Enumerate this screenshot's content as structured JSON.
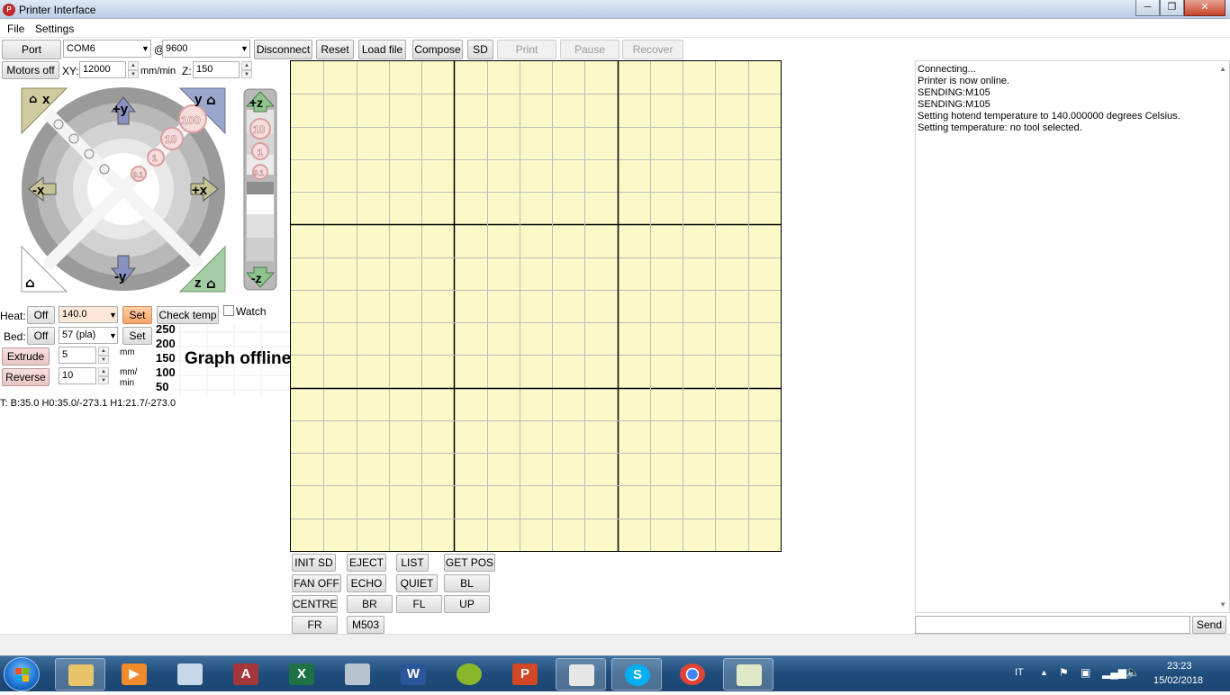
{
  "window": {
    "title": "Printer Interface",
    "icon_text": "P",
    "minimize": "─",
    "maximize": "❐",
    "close": "✕"
  },
  "menu": {
    "file": "File",
    "settings": "Settings"
  },
  "toolbar": {
    "port_label": "Port",
    "port_value": "COM6",
    "at": "@",
    "baud_value": "9600",
    "disconnect": "Disconnect",
    "reset": "Reset",
    "load_file": "Load file",
    "compose": "Compose",
    "sd": "SD",
    "print": "Print",
    "pause": "Pause",
    "recover": "Recover"
  },
  "motion": {
    "motors_off": "Motors off",
    "xy_label": "XY:",
    "xy_value": "12000",
    "xy_unit": "mm/min",
    "z_label": "Z:",
    "z_value": "150"
  },
  "jog": {
    "home_x": "x",
    "home_y": "y",
    "home_z": "z",
    "plus_y": "+y",
    "minus_y": "-y",
    "plus_x": "+x",
    "minus_x": "-x",
    "plus_z": "+z",
    "minus_z": "-z",
    "step_100": "100",
    "step_10": "10",
    "step_1": "1",
    "step_01": "0.1"
  },
  "heat": {
    "label": "Heat:",
    "off": "Off",
    "value": "140.0",
    "set": "Set",
    "check_temp": "Check temp",
    "watch": "Watch"
  },
  "bed": {
    "label": "Bed:",
    "off": "Off",
    "value": "57 (pla)",
    "set": "Set"
  },
  "extrude": {
    "extrude": "Extrude",
    "length": "5",
    "length_unit": "mm",
    "reverse": "Reverse",
    "speed": "10",
    "speed_unit_1": "mm/",
    "speed_unit_2": "min"
  },
  "graph": {
    "ticks": [
      "250",
      "200",
      "150",
      "100",
      "50"
    ],
    "offline": "Graph offline"
  },
  "temps": "T: B:35.0 H0:35.0/-273.1 H1:21.7/-273.0",
  "macros": {
    "init_sd": "INIT SD",
    "eject": "EJECT",
    "list": "LIST",
    "get_pos": "GET POS",
    "fan_off": "FAN OFF",
    "echo": "ECHO",
    "quiet": "QUIET",
    "bl": "BL",
    "centre": "CENTRE",
    "br": "BR",
    "fl": "FL",
    "up": "UP",
    "fr": "FR",
    "m503": "M503"
  },
  "log": {
    "lines": [
      "Connecting...",
      "Printer is now online.",
      "SENDING:M105",
      "SENDING:M105",
      "Setting hotend temperature to 140.000000 degrees Celsius.",
      "Setting temperature: no tool selected."
    ],
    "send": "Send",
    "command_value": ""
  },
  "taskbar": {
    "language": "IT",
    "time": "23:23",
    "date": "15/02/2018",
    "excel_letter": "X",
    "word_letter": "W",
    "ppt_letter": "P",
    "access_letter": "A",
    "skype_letter": "S"
  },
  "colors": {
    "accent_orange": "#f6a26a",
    "grid_bg": "#fbf9c8",
    "taskbar": "#1f4d7b"
  }
}
